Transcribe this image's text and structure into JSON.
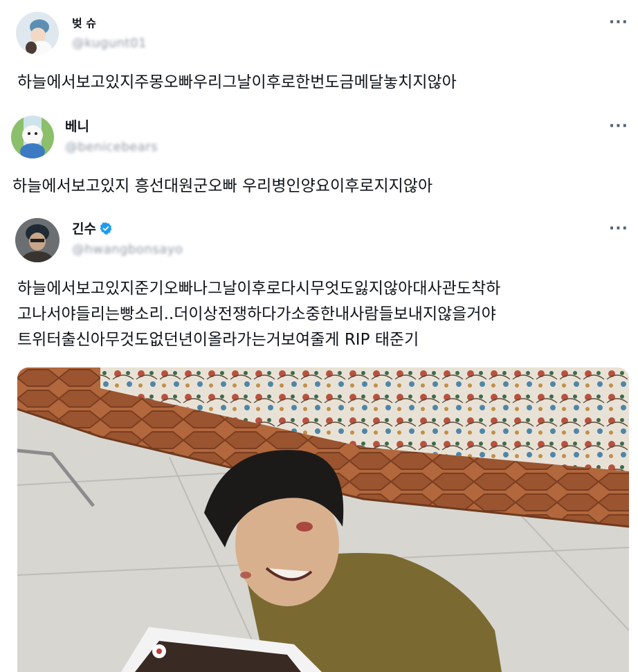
{
  "posts": [
    {
      "name": "벚 슈",
      "handle": "@kugunt01",
      "more": "···",
      "text": "하늘에서보고있지주몽오빠우리그날이후로한번도금메달놓치지않아"
    },
    {
      "name": "베니",
      "handle": "@benicebears",
      "more": "···",
      "text": "하늘에서보고있지 흥선대원군오빠 우리병인양요이후로지지않아"
    },
    {
      "name": "긴수",
      "handle": "@hwangbonsayo",
      "more": "···",
      "verified": true,
      "text_lines": [
        "하늘에서보고있지준기오빠나그날이후로다시무엇도잃지않아대사관도착하",
        "고나서야들리는빵소리..더이상전쟁하다가소중한내사람들보내지않을거야",
        "트위터출신아무것도없던년이올라가는거보여줄게 RIP 태준기"
      ]
    }
  ],
  "colors": {
    "verified": "#1d9bf0",
    "text": "#0f1419",
    "muted": "#536471"
  },
  "icons": {
    "more": "more-icon",
    "verified": "verified-badge-icon"
  }
}
